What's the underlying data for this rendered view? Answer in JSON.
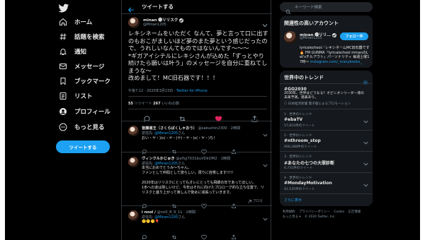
{
  "nav": {
    "items": [
      {
        "label": "ホーム",
        "icon": "home-icon"
      },
      {
        "label": "話題を検索",
        "icon": "hashtag-icon"
      },
      {
        "label": "通知",
        "icon": "bell-icon"
      },
      {
        "label": "メッセージ",
        "icon": "mail-icon"
      },
      {
        "label": "ブックマーク",
        "icon": "bookmark-icon"
      },
      {
        "label": "リスト",
        "icon": "list-icon"
      },
      {
        "label": "プロフィール",
        "icon": "profile-icon"
      },
      {
        "label": "もっと見る",
        "icon": "more-icon"
      }
    ],
    "tweet_button": "ツイートする"
  },
  "header": {
    "title": "ツイートする"
  },
  "tweet": {
    "name": "minan 🅜リリスク",
    "handle": "@Minan1205",
    "text": "レキシネームをいただく なんて、夢と言って口に出すのもおこがましいほど夢のまた夢という感じだったので、うれしいなんてものではないんです〜〜〜\n*ギガアイシテルにレキシさんが込めた「ずっとやり続けたら願いは叶う」のメッセージを自分に重ねてしまうな〜\n改めまして！MC旧石器です！！！",
    "time": "午後7:12 · 2020年3月23日 · ",
    "source": "Twitter for iPhone",
    "retweets": "55",
    "retweets_label": " リツイート  ",
    "likes": "267",
    "likes_label": " いいねの数"
  },
  "replies": [
    {
      "name": "皆藤道王（さくらばくしゃおう）",
      "handle": "@sakushin2300 · 2時間",
      "to_prefix": "返信先: ",
      "to": "@Minan1205",
      "to_suffix": "さん",
      "text": "おい・ヤ・)(ε(・ヤ・)ヤ(・ヤ・)ε(・ヤ・)ち！"
    },
    {
      "name": "ヴィンクルかじゅき",
      "handle": "@aflyj7031buVDkOM2 · 1時間",
      "to_prefix": "返信先: ",
      "to": "@Minan1205",
      "to_suffix": "さん",
      "text": "本当におめでとうみ〜ちゃん。\nファンとして仲間として誇らしい。周りに自慢します!!!!!\n\n2020年はリリスクにとってもオレにとっても飛躍の年であってほしい。\n1歩への道は険しいけど、今年はそれに向けたプロローグ的な立ち位置で、リリスクと盛り上がって楽しんで勢めに頑張っていきます。",
      "promo": "プロモ"
    },
    {
      "name": "i nool /",
      "handle": "@no0_8_9_11 · 1時間",
      "to_prefix": "返信先: ",
      "to": "@Minan1205",
      "to_suffix": "さん",
      "text": "🤫🤫🤫🎈"
    }
  ],
  "search": {
    "placeholder": "キーワード検索"
  },
  "account_panel": {
    "title": "関連性の高いアカウント",
    "name": "minan 🅜リリ…",
    "handle": "@Minan1205",
    "follow": "フォロー中",
    "bio": "lyricalschool／レキシネームMC旧石器です🔥 FM GUNMA『lyricalschool minanのLet'sチルアウト』パーソナリティ 毎週土曜17時〜",
    "bio_link": "instagram.com/_manybooks_"
  },
  "trends_panel": {
    "title": "世界中のトレンド",
    "promoted": {
      "tag": "#GO2030",
      "desc": "2030年、世界はどうなる？オピニオンリーダー達の未来予測。発表あり。",
      "meta": "日本経済新聞 電子版によるプロモーション"
    },
    "items": [
      {
        "category": "1 · 世界のトレンド",
        "name": "#ebaTV",
        "count": "57,810件のツイート"
      },
      {
        "category": "2 · 世界のトレンド",
        "name": "#nthroom_stop",
        "count": "906,288件のツイート"
      },
      {
        "category": "3 · 世界のトレンド",
        "name": "#あなたの七つの大罪診断",
        "count": "6,731件のツイート"
      },
      {
        "category": "4 · 世界のトレンド",
        "name": "#MondayMotivation",
        "count": "41,535件のツイート"
      }
    ],
    "more": "さらに表示"
  },
  "footer": {
    "links": [
      "利用規約",
      "プライバシーポリシー",
      "Cookie",
      "広告情報",
      "もっと見る ▾",
      "© 2020 Twitter, Inc."
    ]
  },
  "colors": {
    "accent": "#1da1f2",
    "like": "#e0245e",
    "background": "#000000",
    "panel": "#15181c"
  }
}
